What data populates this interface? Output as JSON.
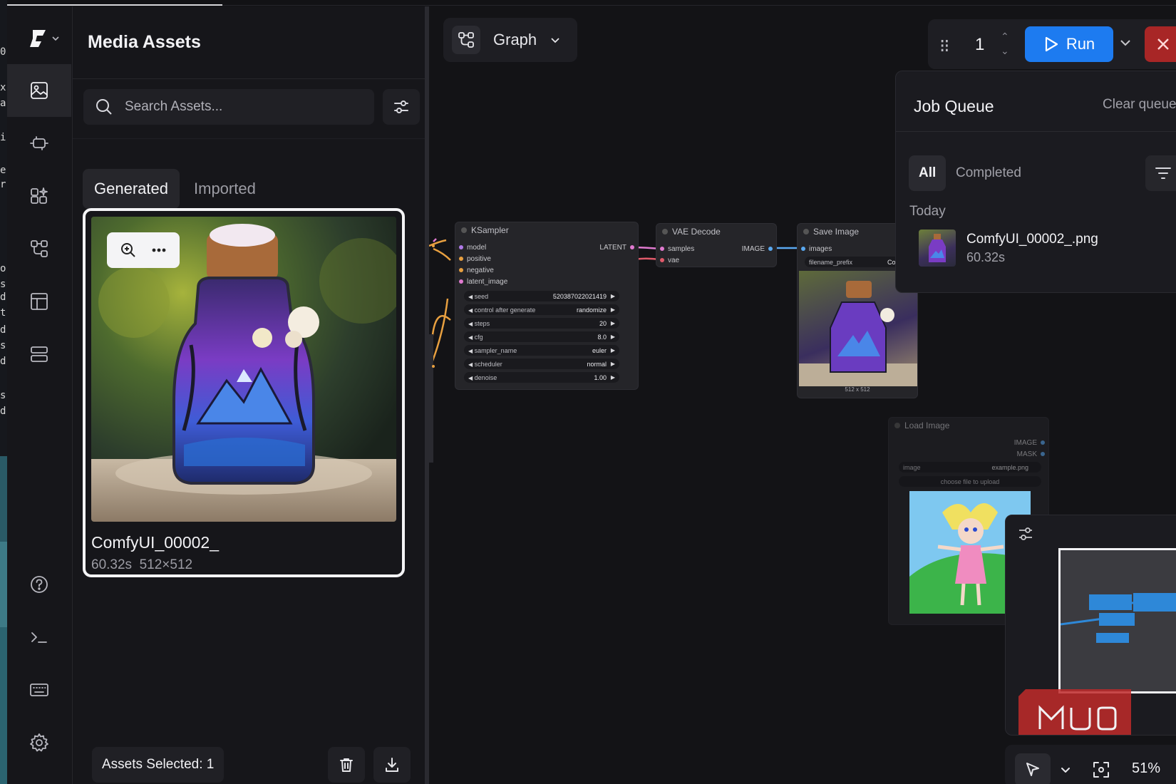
{
  "sidebar": {
    "title": "Media Assets",
    "search": {
      "placeholder": "Search Assets..."
    },
    "tabs": [
      "Generated",
      "Imported"
    ],
    "asset": {
      "name": "ComfyUI_00002_",
      "duration": "60.32s",
      "resolution": "512×512"
    },
    "footer": {
      "selected": "Assets Selected: 1"
    }
  },
  "rail_icons": [
    "comfy-logo-icon",
    "image-icon",
    "model-icon",
    "nodes-icon",
    "workflow-icon",
    "template-icon",
    "queue-icon",
    "help-icon",
    "terminal-icon",
    "keyboard-icon",
    "settings-icon"
  ],
  "toolbar": {
    "view_label": "Graph",
    "batch_count": "1",
    "run_label": "Run"
  },
  "job_queue": {
    "title": "Job Queue",
    "clear_label": "Clear queue",
    "tabs": [
      "All",
      "Completed"
    ],
    "group": "Today",
    "job": {
      "name": "ComfyUI_00002_.png",
      "time": "60.32s"
    }
  },
  "nodes": {
    "ksampler": {
      "title": "KSampler",
      "inputs": [
        "model",
        "positive",
        "negative",
        "latent_image"
      ],
      "output": "LATENT",
      "widgets": [
        {
          "label": "seed",
          "value": "520387022021419"
        },
        {
          "label": "control after generate",
          "value": "randomize"
        },
        {
          "label": "steps",
          "value": "20"
        },
        {
          "label": "cfg",
          "value": "8.0"
        },
        {
          "label": "sampler_name",
          "value": "euler"
        },
        {
          "label": "scheduler",
          "value": "normal"
        },
        {
          "label": "denoise",
          "value": "1.00"
        }
      ]
    },
    "vae_decode": {
      "title": "VAE Decode",
      "inputs": [
        "samples",
        "vae"
      ],
      "output": "IMAGE"
    },
    "save_image": {
      "title": "Save Image",
      "input": "images",
      "prefix_label": "filename_prefix",
      "prefix_value": "Comfy",
      "size": "512 x 512"
    },
    "load_image": {
      "title": "Load Image",
      "outputs": [
        "IMAGE",
        "MASK"
      ],
      "image_label": "image",
      "image_value": "example.png",
      "upload_label": "choose file to upload"
    }
  },
  "zoom": "51%",
  "colors": {
    "accent": "#1d7bf0",
    "stop": "#a82626",
    "link_pink": "#e07ad0",
    "link_orange": "#e8a040",
    "link_blue": "#5aa8f0"
  }
}
